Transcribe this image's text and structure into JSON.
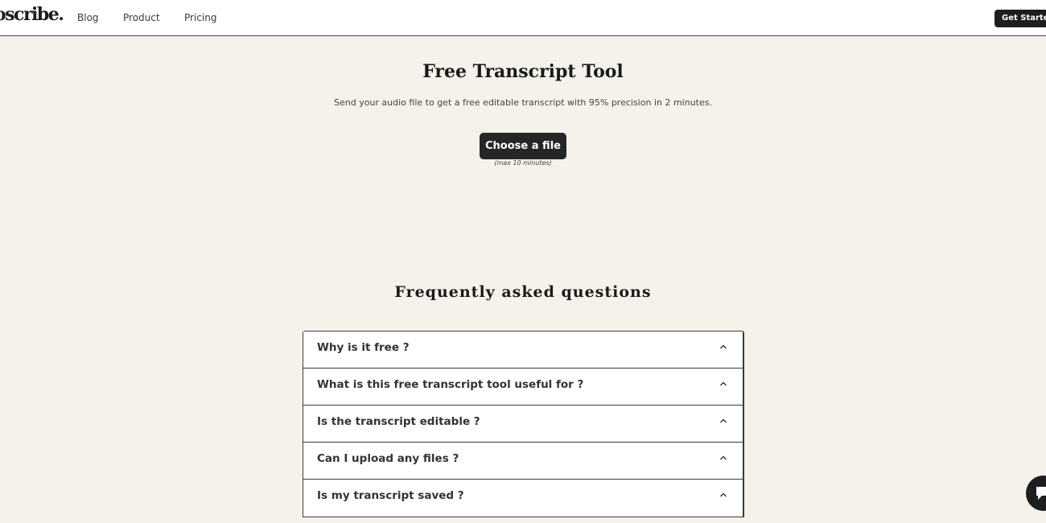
{
  "header": {
    "logo_text": "oscribe.",
    "nav": [
      {
        "label": "Blog"
      },
      {
        "label": "Product"
      },
      {
        "label": "Pricing"
      }
    ],
    "cta_label": "Get Started"
  },
  "hero": {
    "title": "Free Transcript Tool",
    "subtitle": "Send your audio file to get a free editable transcript with 95% precision in 2 minutes.",
    "button_label": "Choose a file",
    "note": "(max 10 minutes)"
  },
  "faq": {
    "title": "Frequently asked questions",
    "items": [
      {
        "question": "Why is it free ?"
      },
      {
        "question": "What is this free transcript tool useful for ?"
      },
      {
        "question": "Is the transcript editable ?"
      },
      {
        "question": "Can I upload any files ?"
      },
      {
        "question": "Is my transcript saved ?"
      }
    ]
  },
  "icons": {
    "faq_toggle": "chevron-up-icon",
    "chat": "chat-bubble-icon"
  },
  "colors": {
    "background": "#f4f2ea",
    "button": "#262626",
    "header": "#ffffff"
  }
}
